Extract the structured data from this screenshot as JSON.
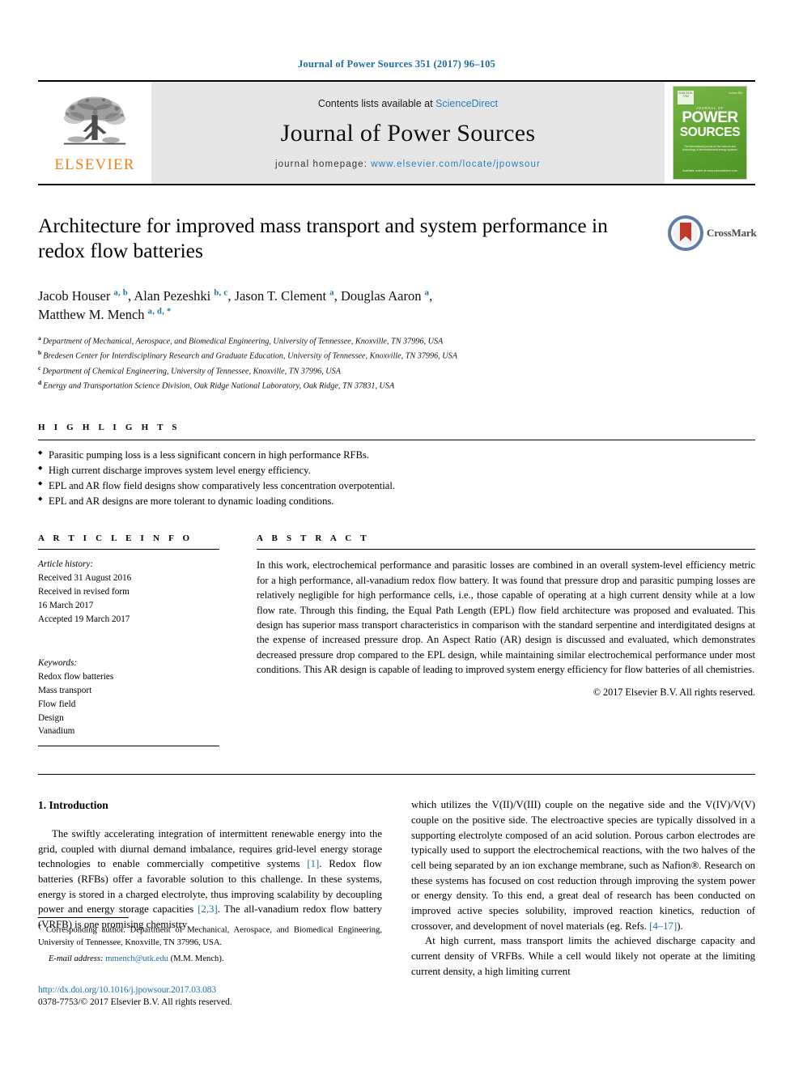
{
  "running_head": "Journal of Power Sources 351 (2017) 96–105",
  "masthead": {
    "contents_prefix": "Contents lists available at",
    "contents_link": "ScienceDirect",
    "journal_name": "Journal of Power Sources",
    "homepage_prefix": "journal homepage:",
    "homepage_url": "www.elsevier.com/locate/jpowsour",
    "publisher": "ELSEVIER",
    "cover": {
      "kicker": "JOURNAL OF",
      "title_line1": "POWER",
      "title_line2": "SOURCES",
      "subtitle": "The international journal on the science and technology of electrochemical energy systems",
      "topbar": "ISSN 0378-7753",
      "issn": "Volume 351",
      "footer": "Available online at www.sciencedirect.com"
    }
  },
  "article": {
    "title": "Architecture for improved mass transport and system performance in redox flow batteries",
    "crossmark_label": "CrossMark",
    "authors": [
      {
        "name": "Jacob Houser",
        "marks": "a, b",
        "sep": ", "
      },
      {
        "name": "Alan Pezeshki",
        "marks": "b, c",
        "sep": ", "
      },
      {
        "name": "Jason T. Clement",
        "marks": "a",
        "sep": ", "
      },
      {
        "name": "Douglas Aaron",
        "marks": "a",
        "sep": ","
      },
      {
        "name": "Matthew M. Mench",
        "marks": "a, d, *",
        "sep": ""
      }
    ],
    "affiliations": [
      {
        "mark": "a",
        "text": "Department of Mechanical, Aerospace, and Biomedical Engineering, University of Tennessee, Knoxville, TN 37996, USA"
      },
      {
        "mark": "b",
        "text": "Bredesen Center for Interdisciplinary Research and Graduate Education, University of Tennessee, Knoxville, TN 37996, USA"
      },
      {
        "mark": "c",
        "text": "Department of Chemical Engineering, University of Tennessee, Knoxville, TN 37996, USA"
      },
      {
        "mark": "d",
        "text": "Energy and Transportation Science Division, Oak Ridge National Laboratory, Oak Ridge, TN 37831, USA"
      }
    ]
  },
  "highlights": {
    "label": "H I G H L I G H T S",
    "items": [
      "Parasitic pumping loss is a less significant concern in high performance RFBs.",
      "High current discharge improves system level energy efficiency.",
      "EPL and AR flow field designs show comparatively less concentration overpotential.",
      "EPL and AR designs are more tolerant to dynamic loading conditions."
    ]
  },
  "article_info": {
    "label": "A R T I C L E   I N F O",
    "history_label": "Article history:",
    "history": [
      "Received 31 August 2016",
      "Received in revised form",
      "16 March 2017",
      "Accepted 19 March 2017"
    ],
    "keywords_label": "Keywords:",
    "keywords": [
      "Redox flow batteries",
      "Mass transport",
      "Flow field",
      "Design",
      "Vanadium"
    ]
  },
  "abstract": {
    "label": "A B S T R A C T",
    "text": "In this work, electrochemical performance and parasitic losses are combined in an overall system-level efficiency metric for a high performance, all-vanadium redox flow battery. It was found that pressure drop and parasitic pumping losses are relatively negligible for high performance cells, i.e., those capable of operating at a high current density while at a low flow rate. Through this finding, the Equal Path Length (EPL) flow field architecture was proposed and evaluated. This design has superior mass transport characteristics in comparison with the standard serpentine and interdigitated designs at the expense of increased pressure drop. An Aspect Ratio (AR) design is discussed and evaluated, which demonstrates decreased pressure drop compared to the EPL design, while maintaining similar electrochemical performance under most conditions. This AR design is capable of leading to improved system energy efficiency for flow batteries of all chemistries.",
    "copyright": "© 2017 Elsevier B.V. All rights reserved."
  },
  "body": {
    "section_number": "1.",
    "section_title": "Introduction",
    "left_paragraph_1": "The swiftly accelerating integration of intermittent renewable energy into the grid, coupled with diurnal demand imbalance, requires grid-level energy storage technologies to enable commercially competitive systems ",
    "left_ref_1": "[1]",
    "left_paragraph_2": ". Redox flow batteries (RFBs) offer a favorable solution to this challenge. In these systems, energy is stored in a charged electrolyte, thus improving scalability by decoupling power and energy storage capacities ",
    "left_ref_2": "[2,3]",
    "left_paragraph_3": ". The all-vanadium redox flow battery (VRFB) is one promising chemistry",
    "right_paragraph_1": "which utilizes the V(II)/V(III) couple on the negative side and the V(IV)/V(V) couple on the positive side. The electroactive species are typically dissolved in a supporting electrolyte composed of an acid solution. Porous carbon electrodes are typically used to support the electrochemical reactions, with the two halves of the cell being separated by an ion exchange membrane, such as Nafion®. Research on these systems has focused on cost reduction through improving the system power or energy density. To this end, a great deal of research has been conducted on improved active species solubility, improved reaction kinetics, reduction of crossover, and development of novel materials (eg. Refs. ",
    "right_ref_1": "[4–17]",
    "right_paragraph_2": ").",
    "right_paragraph_3": "At high current, mass transport limits the achieved discharge capacity and current density of VRFBs. While a cell would likely not operate at the limiting current density, a high limiting current"
  },
  "footnotes": {
    "corresponding_star": "*",
    "corresponding": " Corresponding author. Department of Mechanical, Aerospace, and Biomedical Engineering, University of Tennessee, Knoxville, TN 37996, USA.",
    "email_label": "E-mail address:",
    "email": "mmench@utk.edu",
    "email_owner": "(M.M. Mench)."
  },
  "doi": {
    "url": "http://dx.doi.org/10.1016/j.jpowsour.2017.03.083",
    "issn_line": "0378-7753/© 2017 Elsevier B.V. All rights reserved."
  },
  "colors": {
    "link_blue": "#1a6fa8",
    "sciencedirect_blue": "#2a7fbe",
    "elsevier_orange": "#f08220",
    "cover_green": "#5da32f",
    "crossmark_red": "#c0392b"
  }
}
